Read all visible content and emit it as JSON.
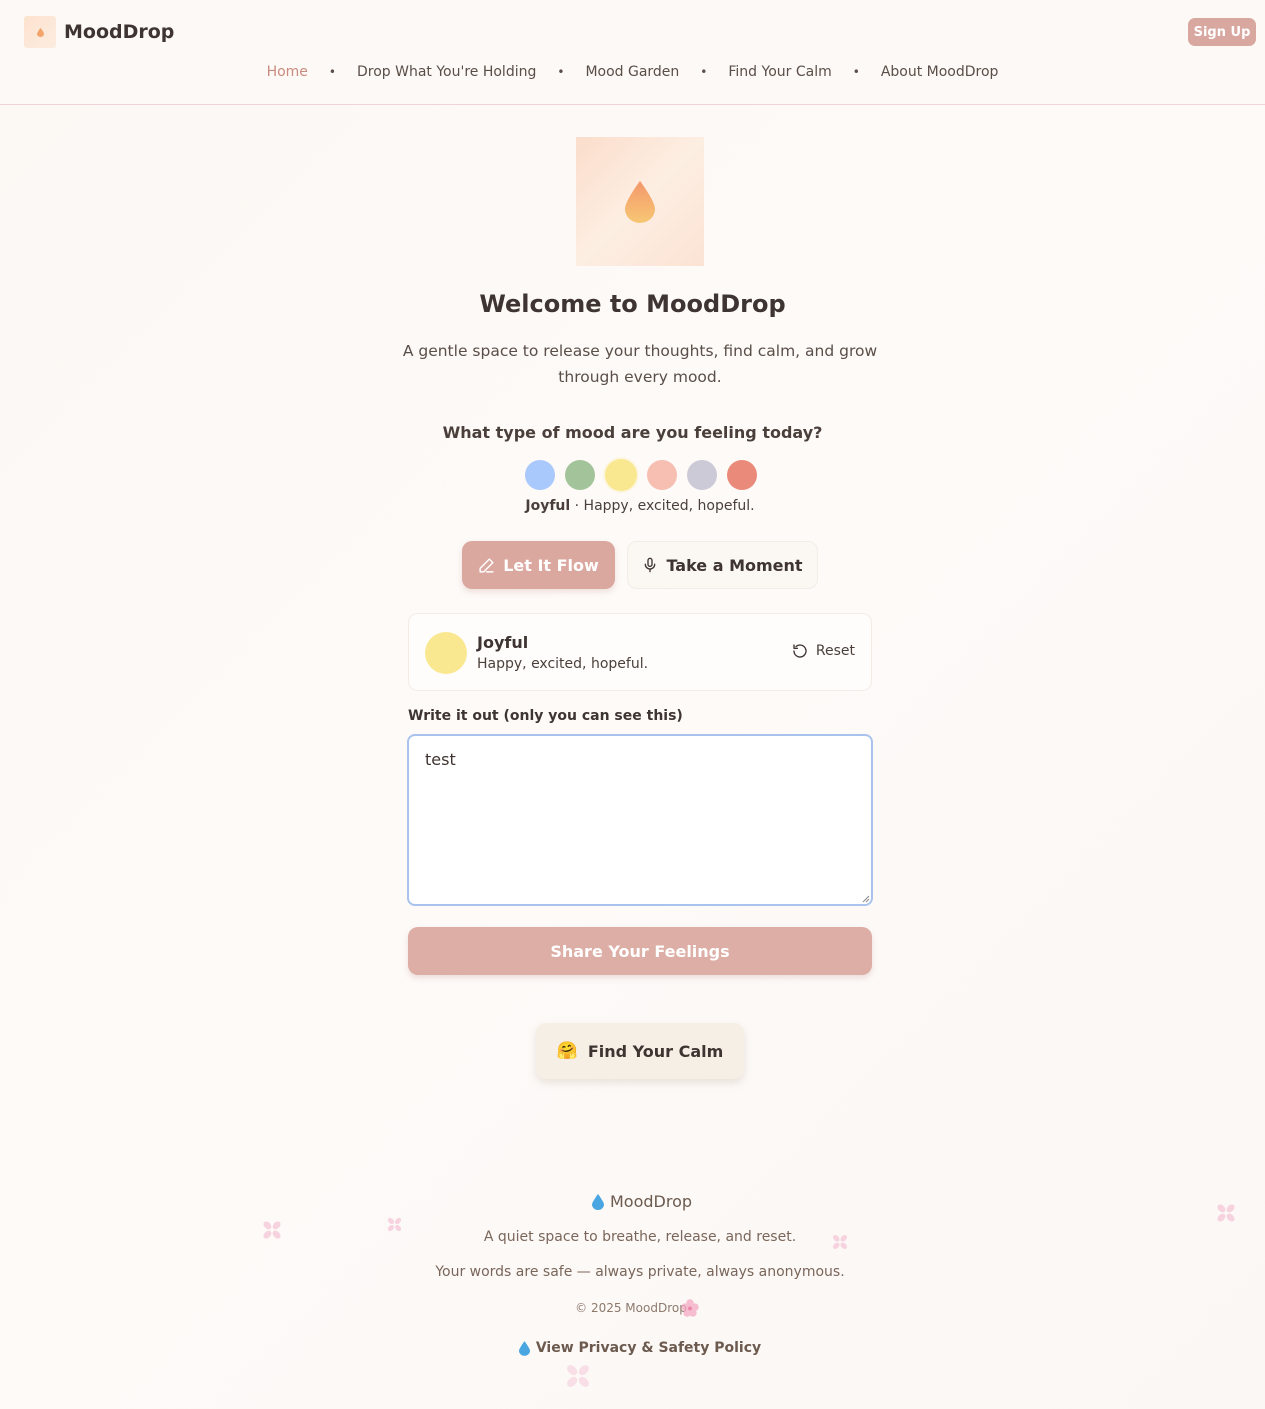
{
  "colors": {
    "accent": "#dba89f",
    "nav_active": "#c98b7e",
    "border_pink": "#f2d3d8",
    "focus_blue": "#a9c3ee"
  },
  "header": {
    "brand": "MoodDrop",
    "signup_label": "Sign Up",
    "nav": [
      {
        "label": "Home",
        "active": true
      },
      {
        "label": "Drop What You're Holding"
      },
      {
        "label": "Mood Garden"
      },
      {
        "label": "Find Your Calm"
      },
      {
        "label": "About MoodDrop"
      }
    ]
  },
  "hero": {
    "title": "Welcome to MoodDrop",
    "subtitle": "A gentle space to release your thoughts, find calm, and grow through every mood."
  },
  "mood_picker": {
    "question": "What type of mood are you feeling today?",
    "moods": [
      {
        "color": "#a9c8fb"
      },
      {
        "color": "#a3c39b"
      },
      {
        "color": "#fae890",
        "selected": true
      },
      {
        "color": "#f6bfb1"
      },
      {
        "color": "#cdcad8"
      },
      {
        "color": "#ea8a7a"
      }
    ],
    "selected_name": "Joyful",
    "selected_caption": " · Happy, excited, hopeful."
  },
  "modes": {
    "flow_label": "Let It Flow",
    "moment_label": "Take a Moment"
  },
  "mood_card": {
    "name": "Joyful",
    "description": "Happy, excited, hopeful.",
    "reset_label": "Reset"
  },
  "entry": {
    "label": "Write it out (only you can see this)",
    "value": "test"
  },
  "actions": {
    "share_label": "Share Your Feelings",
    "calm_label": "Find Your Calm",
    "calm_emoji": "🤗"
  },
  "footer": {
    "brand": "MoodDrop",
    "line1": "A quiet space to breathe, release, and reset.",
    "line2": "Your words are safe — always private, always anonymous.",
    "copyright": "© 2025 MoodDrop",
    "policy_label": "View Privacy & Safety Policy"
  }
}
